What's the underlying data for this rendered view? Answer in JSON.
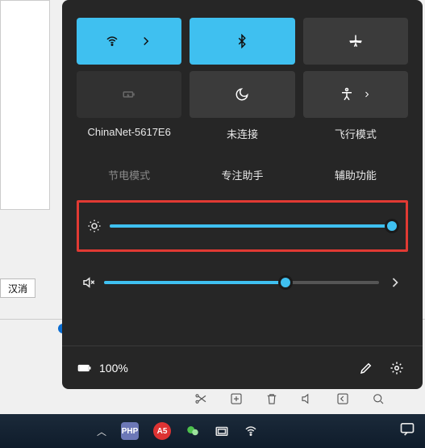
{
  "bg": {
    "cancel": "汉消"
  },
  "tiles": {
    "wifi": {
      "label": "ChinaNet-5617E6",
      "active": true
    },
    "bluetooth": {
      "label": "未连接",
      "active": true
    },
    "airplane": {
      "label": "飞行模式",
      "active": false
    },
    "battery": {
      "label": "节电模式",
      "active": false
    },
    "focus": {
      "label": "专注助手",
      "active": false
    },
    "access": {
      "label": "辅助功能",
      "active": false
    }
  },
  "sliders": {
    "brightness": {
      "percent": 98
    },
    "volume": {
      "percent": 66
    }
  },
  "footer": {
    "battery_text": "100%"
  },
  "taskbar": {
    "php_label": "PHP",
    "a5_label": "A5"
  }
}
